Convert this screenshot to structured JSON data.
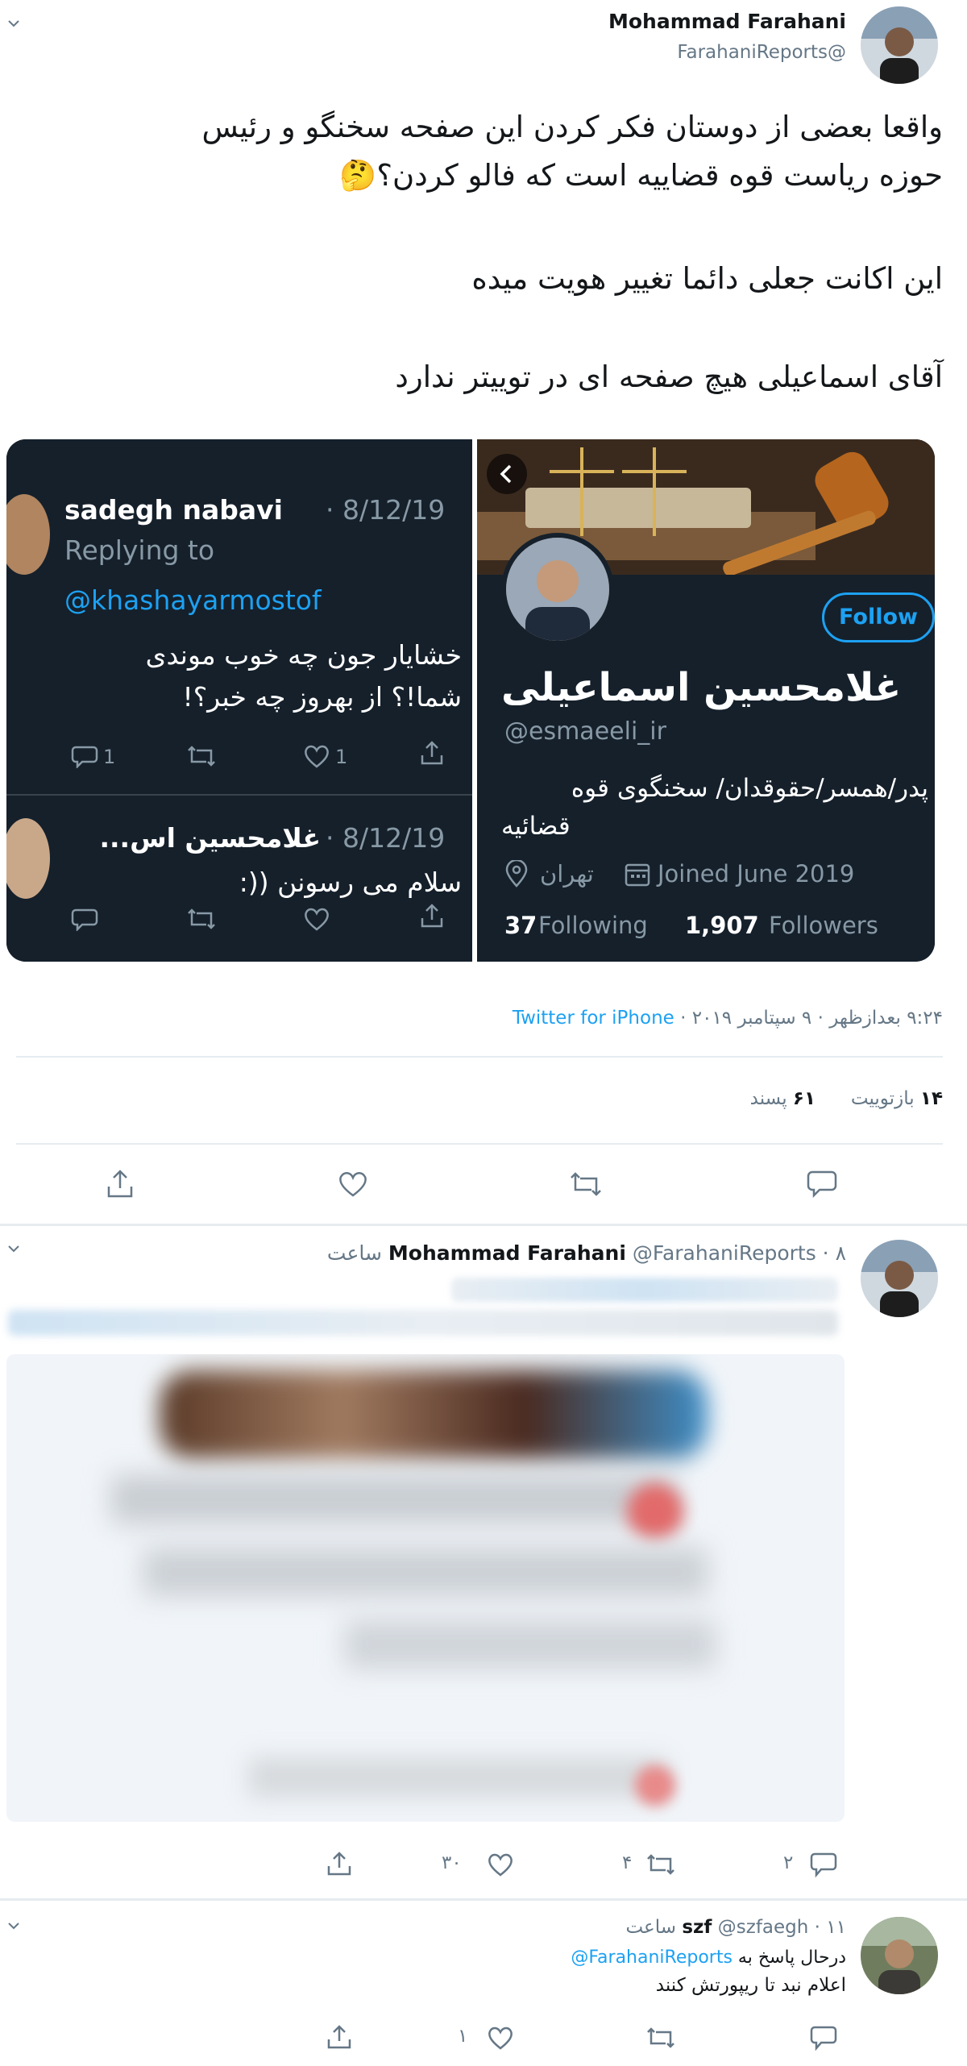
{
  "tweet1": {
    "author_name": "Mohammad Farahani",
    "author_handle": "@FarahaniReports",
    "text_line1": "واقعا بعضی از دوستان فکر کردن این صفحه سخنگو و رئیس",
    "text_line2": "حوزه ریاست قوه قضاییه است که فالو کردن؟🤔",
    "text_para2": "این اکانت جعلی دائما تغییر هویت میده",
    "text_para3": "آقای اسماعیلی هیچ صفحه ای در توییتر ندارد",
    "meta_source": "Twitter for iPhone",
    "meta_time": "۹:۲۴ بعدازظهر · ۹ سپتامبر ۲۰۱۹ · ",
    "retweets_count": "۱۴",
    "retweets_label": "بازتوییت",
    "likes_count": "۶۱",
    "likes_label": "پسند"
  },
  "card_left": {
    "reply1_name": "sadegh nabavi",
    "reply1_date": "· 8/12/19",
    "replying_to": "Replying to",
    "replying_handle": "@khashayarmostof",
    "reply1_text1": "خشایار جون چه خوب موندی",
    "reply1_text2": "شما!؟ از بهروز چه خبر؟!",
    "reply1_replies": "1",
    "reply1_likes": "1",
    "reply2_name": "غلامحسین اس...",
    "reply2_date": "· 8/12/19",
    "reply2_text": "سلام می رسونن ((:"
  },
  "card_right": {
    "follow_label": "Follow",
    "profile_name": "غلامحسین اسماعیلی",
    "profile_handle": "@esmaeeli_ir",
    "bio_line1": "پدر/همسر/حقوقدان/ سخنگوی قوه",
    "bio_line2": "قضائیه",
    "location": "تهران",
    "joined": "Joined June 2019",
    "following_count": "37",
    "following_label": "Following",
    "followers_count": "1,907",
    "followers_label": "Followers"
  },
  "tweet2": {
    "author_name": "Mohammad Farahani",
    "author_handle": "@FarahaniReports",
    "time": "· ۸ ساعت",
    "replies": "۲",
    "retweets": "۴",
    "likes": "۳۰"
  },
  "tweet3": {
    "author_name": "szf",
    "author_handle": "@szfaegh",
    "time": "· ۱۱ ساعت",
    "replying_prefix": "درحال پاسخ به",
    "replying_handle": "FarahaniReports@",
    "text": "اعلام نبد تا ریپورتش کنند",
    "likes": "۱"
  },
  "colors": {
    "accent": "#1da1f2",
    "muted": "#657786",
    "dark_bg": "#15202b"
  }
}
